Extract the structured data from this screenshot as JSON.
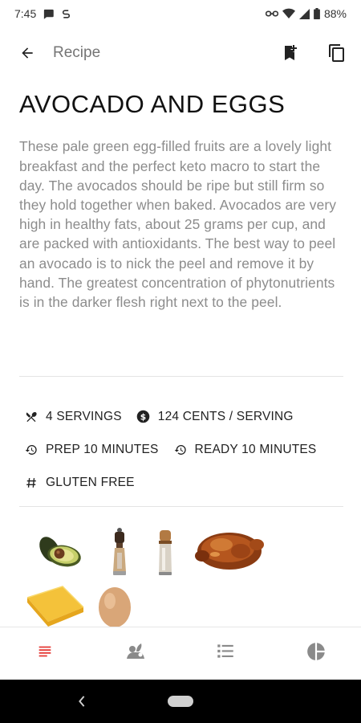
{
  "status_bar": {
    "time": "7:45",
    "battery": "88%",
    "icons": [
      "message-icon",
      "sync-icon",
      "vpn-key-icon",
      "wifi-icon",
      "signal-icon",
      "battery-icon"
    ]
  },
  "app_bar": {
    "title": "Recipe",
    "icons": [
      "back-arrow-icon",
      "bookmark-add-icon",
      "copy-icon"
    ]
  },
  "recipe": {
    "title": "AVOCADO AND EGGS",
    "description": "These pale green egg-filled fruits are a lovely light breakfast and the perfect keto macro to start the day. The avocados should be ripe but still firm so they hold together when baked. Avocados are very high in healthy fats, about 25 grams per cup, and are packed with antioxidants. The best way to peel an avocado is to nick the peel and remove it by hand. The greatest concentration of phytonutrients is in the darker flesh right next to the peel."
  },
  "meta": {
    "servings": "4 SERVINGS",
    "cost": "124 CENTS / SERVING",
    "prep": "PREP 10 MINUTES",
    "ready": "READY 10 MINUTES",
    "diet": "GLUTEN FREE"
  },
  "ingredients": [
    "avocado",
    "pepper-mill",
    "salt-shaker",
    "roast-chicken",
    "cheese",
    "egg"
  ],
  "bottom_nav": {
    "items": [
      "summary-icon",
      "ingredients-icon",
      "instructions-icon",
      "nutrition-icon"
    ],
    "active": "summary-icon",
    "active_color": "#e53935",
    "inactive_color": "#8a8a8a"
  }
}
